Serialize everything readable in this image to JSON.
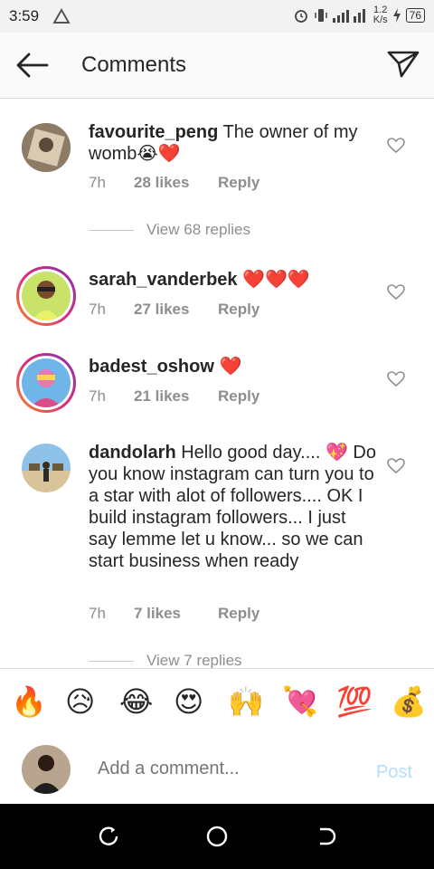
{
  "status_bar": {
    "time": "3:59",
    "signal_label": "4G",
    "speed_value": "1.2",
    "speed_unit": "K/s",
    "battery": "76"
  },
  "header": {
    "title": "Comments"
  },
  "comments": [
    {
      "username": "favourite_peng",
      "text": "The owner of my womb😭❤️",
      "time": "7h",
      "likes": "28 likes",
      "reply": "Reply",
      "view_replies": "View 68 replies"
    },
    {
      "username": "sarah_vanderbek",
      "text": "❤️❤️❤️",
      "time": "7h",
      "likes": "27 likes",
      "reply": "Reply"
    },
    {
      "username": "badest_oshow",
      "text": "❤️",
      "time": "7h",
      "likes": "21 likes",
      "reply": "Reply"
    },
    {
      "username": "dandolarh",
      "text": "Hello good day.... 💖 Do you know instagram can turn you to a star with alot of followers.... OK I build instagram followers... I just say lemme let u know... so we can start business when ready",
      "time": "7h",
      "likes": "7 likes",
      "reply": "Reply",
      "view_replies": "View 7 replies"
    }
  ],
  "emoji_bar": [
    "🔥",
    "😥",
    "😂",
    "😍",
    "🙌",
    "💘",
    "💯",
    "💰"
  ],
  "compose": {
    "placeholder": "Add a comment...",
    "post_label": "Post"
  },
  "colors": {
    "accent_post": "#b2dffc",
    "heart": "#e0245e",
    "story_ring_start": "#f58529",
    "story_ring_end": "#8134af"
  }
}
